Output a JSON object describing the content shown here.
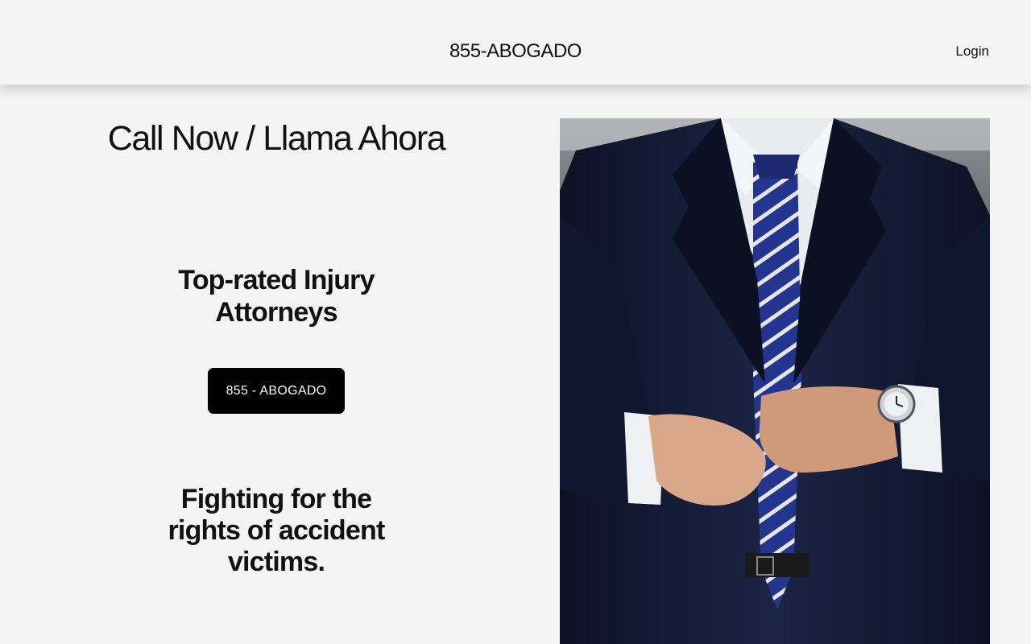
{
  "header": {
    "brand": "855-ABOGADO",
    "login_label": "Login"
  },
  "hero": {
    "headline": "Call Now / Llama Ahora",
    "subheadline": "Top-rated Injury Attorneys",
    "cta_label": "855 - ABOGADO",
    "tagline": "Fighting for the rights of accident victims."
  },
  "photo": {
    "subject": "man-in-suit-buttoning-jacket"
  },
  "colors": {
    "background": "#f4f4f4",
    "text": "#111111",
    "button_bg": "#000000",
    "button_text": "#ffffff",
    "suit": "#141b33",
    "tie_blue": "#2a3f9e"
  }
}
